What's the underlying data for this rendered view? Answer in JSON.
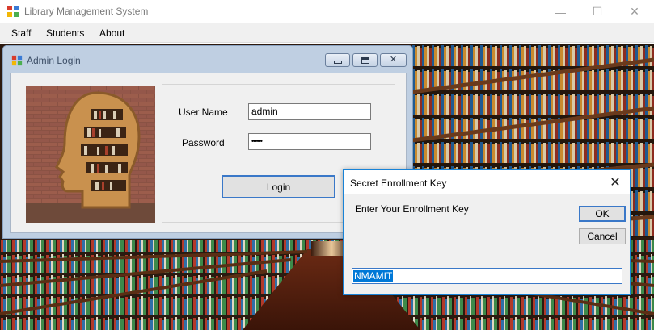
{
  "window": {
    "title": "Library Management System",
    "controls": {
      "minimize": "—",
      "maximize": "☐",
      "close": "✕"
    }
  },
  "menu": {
    "items": [
      "Staff",
      "Students",
      "About"
    ]
  },
  "admin_login": {
    "title": "Admin Login",
    "user_name_label": "User Name",
    "user_name_value": "admin",
    "password_label": "Password",
    "password_value": "••••••",
    "login_button": "Login",
    "close_glyph": "✕"
  },
  "enrollment_dialog": {
    "title": "Secret Enrollment Key",
    "close_glyph": "✕",
    "prompt": "Enter Your Enrollment Key",
    "ok_button": "OK",
    "cancel_button": "Cancel",
    "input_value": "NMAMIT"
  },
  "colors": {
    "accent": "#0078d7",
    "focus_border": "#3a78c8",
    "mdi_frame": "#bfcfe2",
    "dialog_border": "#1883d7"
  },
  "icons": [
    "app-icon",
    "admin-window-icon",
    "head-bookshelf-image",
    "library-background"
  ]
}
